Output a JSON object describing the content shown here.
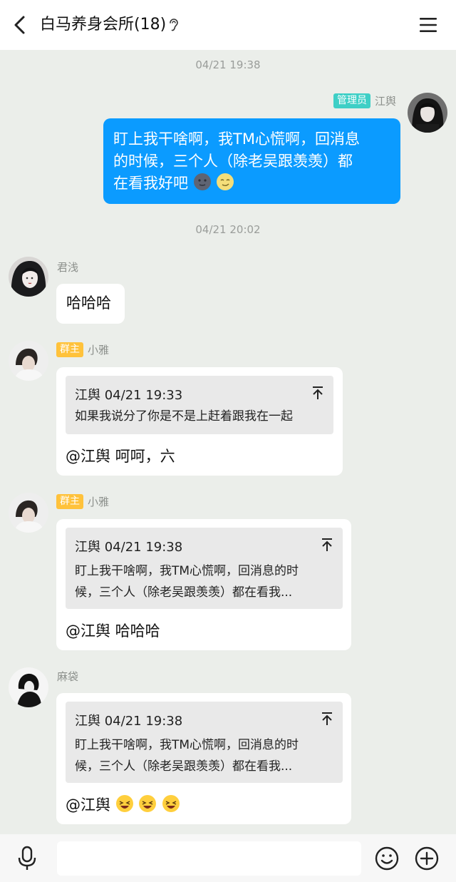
{
  "header": {
    "title": "白马养身会所(18)"
  },
  "messages": [
    {
      "timestamp": "04/21 19:38",
      "badge": "管理员",
      "sender": "江舆",
      "lines": [
        "盯上我干啥啊，我TM心慌啊，回消息",
        "的时候，三个人（除老吴跟羡羡）都",
        "在看我好吧"
      ],
      "emojis": [
        "new-moon-face",
        "moon-face"
      ]
    },
    {
      "timestamp": "04/21 20:02",
      "sender": "君浅",
      "text": "哈哈哈"
    },
    {
      "badge": "群主",
      "sender": "小雅",
      "quote": {
        "header": "江舆 04/21 19:33",
        "lines": [
          "如果我说分了你是不是上赶着跟我在一起"
        ]
      },
      "reply": "@江舆 呵呵，六"
    },
    {
      "badge": "群主",
      "sender": "小雅",
      "quote": {
        "header": "江舆 04/21 19:38",
        "lines": [
          "盯上我干啥啊，我TM心慌啊，回消息的时",
          "候，三个人（除老吴跟羡羡）都在看我..."
        ]
      },
      "reply": "@江舆 哈哈哈"
    },
    {
      "sender": "麻袋",
      "quote": {
        "header": "江舆 04/21 19:38",
        "lines": [
          "盯上我干啥啊，我TM心慌啊，回消息的时",
          "候，三个人（除老吴跟羡羡）都在看我..."
        ]
      },
      "reply": "@江舆",
      "emojis": [
        "laughing-face",
        "laughing-face",
        "laughing-face"
      ]
    }
  ],
  "colors": {
    "background": "#ebeeea",
    "outgoing_bubble": "#0b9bff",
    "admin_badge": "#3ecfc6",
    "owner_badge": "#ffc23b"
  },
  "icons": [
    "back-arrow-icon",
    "ear-icon",
    "menu-icon",
    "microphone-icon",
    "emoji-smile-icon",
    "plus-circle-icon"
  ]
}
